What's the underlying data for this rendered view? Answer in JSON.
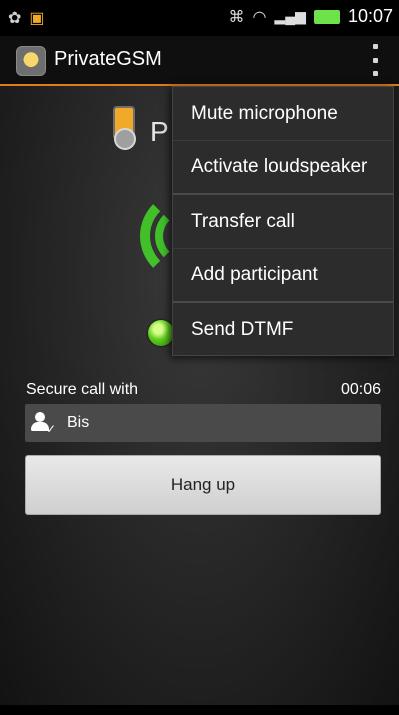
{
  "status_bar": {
    "time": "10:07",
    "icons": [
      "star-icon",
      "app-notification-icon",
      "usb-icon",
      "wifi-icon",
      "signal-icon",
      "battery-icon"
    ],
    "battery_color": "#6de24a"
  },
  "action_bar": {
    "title": "PrivateGSM",
    "accent_color": "#e27b1a"
  },
  "call": {
    "caller_initial": "P",
    "secure_label": "Secure call with",
    "duration": "00:06",
    "participant": "Bis",
    "hangup_label": "Hang up",
    "status_color": "#41c02a"
  },
  "menu": {
    "items": [
      {
        "label": "Mute microphone"
      },
      {
        "label": "Activate loudspeaker"
      },
      {
        "label": "Transfer call"
      },
      {
        "label": "Add participant"
      },
      {
        "label": "Send DTMF"
      }
    ]
  }
}
